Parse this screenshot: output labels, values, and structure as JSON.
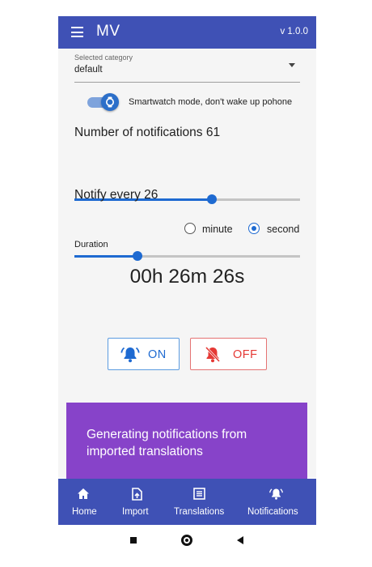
{
  "appbar": {
    "title": "MV",
    "version": "v 1.0.0"
  },
  "category": {
    "label": "Selected category",
    "value": "default"
  },
  "smartwatch": {
    "label": "Smartwatch mode, don't wake up pohone",
    "enabled": true
  },
  "notifications": {
    "label": "Number of notifications 61",
    "value": 61,
    "slider_fraction": 0.61
  },
  "notify_every": {
    "label": "Notify every 26",
    "value": 26,
    "slider_fraction": 0.28,
    "options": [
      {
        "label": "minute",
        "selected": false
      },
      {
        "label": "second",
        "selected": true
      }
    ]
  },
  "duration": {
    "label": "Duration",
    "value": "00h 26m 26s"
  },
  "buttons": {
    "on_label": "ON",
    "off_label": "OFF"
  },
  "banner": {
    "text": "Generating notifications from imported translations",
    "color": "#8743c9"
  },
  "nav": {
    "items": [
      {
        "label": "Home",
        "icon": "home-icon"
      },
      {
        "label": "Import",
        "icon": "import-icon"
      },
      {
        "label": "Translations",
        "icon": "translations-icon"
      },
      {
        "label": "Notifications",
        "icon": "bell-icon",
        "active": true
      }
    ]
  },
  "colors": {
    "primary": "#3f51b5",
    "accent": "#1e6ad1",
    "danger": "#e53935"
  }
}
